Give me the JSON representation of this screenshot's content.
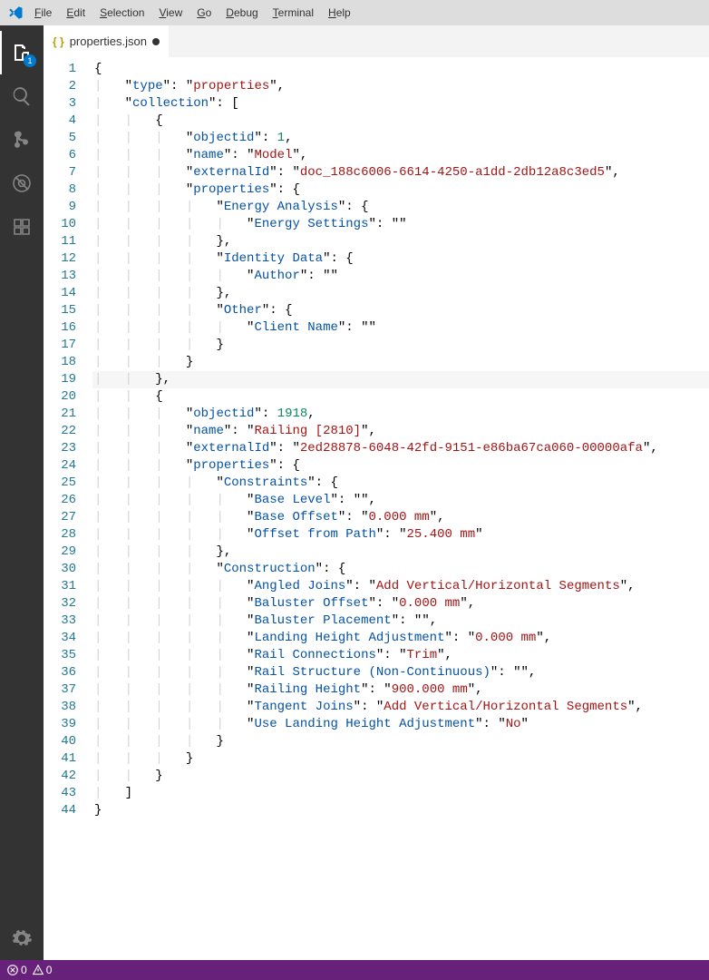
{
  "menubar": {
    "items": [
      {
        "label": "File",
        "ul": "F",
        "rest": "ile"
      },
      {
        "label": "Edit",
        "ul": "E",
        "rest": "dit"
      },
      {
        "label": "Selection",
        "ul": "S",
        "rest": "election"
      },
      {
        "label": "View",
        "ul": "V",
        "rest": "iew"
      },
      {
        "label": "Go",
        "ul": "G",
        "rest": "o"
      },
      {
        "label": "Debug",
        "ul": "D",
        "rest": "ebug"
      },
      {
        "label": "Terminal",
        "ul": "T",
        "rest": "erminal"
      },
      {
        "label": "Help",
        "ul": "H",
        "rest": "elp"
      }
    ]
  },
  "activitybar": {
    "explorer_badge": "1"
  },
  "tab": {
    "filename": "properties.json"
  },
  "code": {
    "lines": [
      [
        [
          "p",
          "{"
        ]
      ],
      [
        [
          "sp",
          "    "
        ],
        [
          "p",
          "\""
        ],
        [
          "k",
          "type"
        ],
        [
          "p",
          "\": "
        ],
        [
          "p",
          "\""
        ],
        [
          "s",
          "properties"
        ],
        [
          "p",
          "\","
        ]
      ],
      [
        [
          "sp",
          "    "
        ],
        [
          "p",
          "\""
        ],
        [
          "k",
          "collection"
        ],
        [
          "p",
          "\": ["
        ]
      ],
      [
        [
          "sp",
          "        "
        ],
        [
          "p",
          "{"
        ]
      ],
      [
        [
          "sp",
          "            "
        ],
        [
          "p",
          "\""
        ],
        [
          "k",
          "objectid"
        ],
        [
          "p",
          "\": "
        ],
        [
          "n",
          "1"
        ],
        [
          "p",
          ","
        ]
      ],
      [
        [
          "sp",
          "            "
        ],
        [
          "p",
          "\""
        ],
        [
          "k",
          "name"
        ],
        [
          "p",
          "\": "
        ],
        [
          "p",
          "\""
        ],
        [
          "s",
          "Model"
        ],
        [
          "p",
          "\","
        ]
      ],
      [
        [
          "sp",
          "            "
        ],
        [
          "p",
          "\""
        ],
        [
          "k",
          "externalId"
        ],
        [
          "p",
          "\": "
        ],
        [
          "p",
          "\""
        ],
        [
          "s",
          "doc_188c6006-6614-4250-a1dd-2db12a8c3ed5"
        ],
        [
          "p",
          "\","
        ]
      ],
      [
        [
          "sp",
          "            "
        ],
        [
          "p",
          "\""
        ],
        [
          "k",
          "properties"
        ],
        [
          "p",
          "\": {"
        ]
      ],
      [
        [
          "sp",
          "                "
        ],
        [
          "p",
          "\""
        ],
        [
          "k",
          "Energy Analysis"
        ],
        [
          "p",
          "\": {"
        ]
      ],
      [
        [
          "sp",
          "                    "
        ],
        [
          "p",
          "\""
        ],
        [
          "k",
          "Energy Settings"
        ],
        [
          "p",
          "\": "
        ],
        [
          "p",
          "\""
        ],
        [
          "p",
          "\""
        ]
      ],
      [
        [
          "sp",
          "                "
        ],
        [
          "p",
          "},"
        ]
      ],
      [
        [
          "sp",
          "                "
        ],
        [
          "p",
          "\""
        ],
        [
          "k",
          "Identity Data"
        ],
        [
          "p",
          "\": {"
        ]
      ],
      [
        [
          "sp",
          "                    "
        ],
        [
          "p",
          "\""
        ],
        [
          "k",
          "Author"
        ],
        [
          "p",
          "\": "
        ],
        [
          "p",
          "\""
        ],
        [
          "p",
          "\""
        ]
      ],
      [
        [
          "sp",
          "                "
        ],
        [
          "p",
          "},"
        ]
      ],
      [
        [
          "sp",
          "                "
        ],
        [
          "p",
          "\""
        ],
        [
          "k",
          "Other"
        ],
        [
          "p",
          "\": {"
        ]
      ],
      [
        [
          "sp",
          "                    "
        ],
        [
          "p",
          "\""
        ],
        [
          "k",
          "Client Name"
        ],
        [
          "p",
          "\": "
        ],
        [
          "p",
          "\""
        ],
        [
          "p",
          "\""
        ]
      ],
      [
        [
          "sp",
          "                "
        ],
        [
          "p",
          "}"
        ]
      ],
      [
        [
          "sp",
          "            "
        ],
        [
          "p",
          "}"
        ]
      ],
      [
        [
          "sp",
          "        "
        ],
        [
          "p",
          "},"
        ]
      ],
      [
        [
          "sp",
          "        "
        ],
        [
          "p",
          "{"
        ]
      ],
      [
        [
          "sp",
          "            "
        ],
        [
          "p",
          "\""
        ],
        [
          "k",
          "objectid"
        ],
        [
          "p",
          "\": "
        ],
        [
          "n",
          "1918"
        ],
        [
          "p",
          ","
        ]
      ],
      [
        [
          "sp",
          "            "
        ],
        [
          "p",
          "\""
        ],
        [
          "k",
          "name"
        ],
        [
          "p",
          "\": "
        ],
        [
          "p",
          "\""
        ],
        [
          "s",
          "Railing [2810]"
        ],
        [
          "p",
          "\","
        ]
      ],
      [
        [
          "sp",
          "            "
        ],
        [
          "p",
          "\""
        ],
        [
          "k",
          "externalId"
        ],
        [
          "p",
          "\": "
        ],
        [
          "p",
          "\""
        ],
        [
          "s",
          "2ed28878-6048-42fd-9151-e86ba67ca060-00000afa"
        ],
        [
          "p",
          "\","
        ]
      ],
      [
        [
          "sp",
          "            "
        ],
        [
          "p",
          "\""
        ],
        [
          "k",
          "properties"
        ],
        [
          "p",
          "\": {"
        ]
      ],
      [
        [
          "sp",
          "                "
        ],
        [
          "p",
          "\""
        ],
        [
          "k",
          "Constraints"
        ],
        [
          "p",
          "\": {"
        ]
      ],
      [
        [
          "sp",
          "                    "
        ],
        [
          "p",
          "\""
        ],
        [
          "k",
          "Base Level"
        ],
        [
          "p",
          "\": "
        ],
        [
          "p",
          "\""
        ],
        [
          "p",
          "\","
        ]
      ],
      [
        [
          "sp",
          "                    "
        ],
        [
          "p",
          "\""
        ],
        [
          "k",
          "Base Offset"
        ],
        [
          "p",
          "\": "
        ],
        [
          "p",
          "\""
        ],
        [
          "s",
          "0.000 mm"
        ],
        [
          "p",
          "\","
        ]
      ],
      [
        [
          "sp",
          "                    "
        ],
        [
          "p",
          "\""
        ],
        [
          "k",
          "Offset from Path"
        ],
        [
          "p",
          "\": "
        ],
        [
          "p",
          "\""
        ],
        [
          "s",
          "25.400 mm"
        ],
        [
          "p",
          "\""
        ]
      ],
      [
        [
          "sp",
          "                "
        ],
        [
          "p",
          "},"
        ]
      ],
      [
        [
          "sp",
          "                "
        ],
        [
          "p",
          "\""
        ],
        [
          "k",
          "Construction"
        ],
        [
          "p",
          "\": {"
        ]
      ],
      [
        [
          "sp",
          "                    "
        ],
        [
          "p",
          "\""
        ],
        [
          "k",
          "Angled Joins"
        ],
        [
          "p",
          "\": "
        ],
        [
          "p",
          "\""
        ],
        [
          "s",
          "Add Vertical/Horizontal Segments"
        ],
        [
          "p",
          "\","
        ]
      ],
      [
        [
          "sp",
          "                    "
        ],
        [
          "p",
          "\""
        ],
        [
          "k",
          "Baluster Offset"
        ],
        [
          "p",
          "\": "
        ],
        [
          "p",
          "\""
        ],
        [
          "s",
          "0.000 mm"
        ],
        [
          "p",
          "\","
        ]
      ],
      [
        [
          "sp",
          "                    "
        ],
        [
          "p",
          "\""
        ],
        [
          "k",
          "Baluster Placement"
        ],
        [
          "p",
          "\": "
        ],
        [
          "p",
          "\""
        ],
        [
          "p",
          "\","
        ]
      ],
      [
        [
          "sp",
          "                    "
        ],
        [
          "p",
          "\""
        ],
        [
          "k",
          "Landing Height Adjustment"
        ],
        [
          "p",
          "\": "
        ],
        [
          "p",
          "\""
        ],
        [
          "s",
          "0.000 mm"
        ],
        [
          "p",
          "\","
        ]
      ],
      [
        [
          "sp",
          "                    "
        ],
        [
          "p",
          "\""
        ],
        [
          "k",
          "Rail Connections"
        ],
        [
          "p",
          "\": "
        ],
        [
          "p",
          "\""
        ],
        [
          "s",
          "Trim"
        ],
        [
          "p",
          "\","
        ]
      ],
      [
        [
          "sp",
          "                    "
        ],
        [
          "p",
          "\""
        ],
        [
          "k",
          "Rail Structure (Non-Continuous)"
        ],
        [
          "p",
          "\": "
        ],
        [
          "p",
          "\""
        ],
        [
          "p",
          "\","
        ]
      ],
      [
        [
          "sp",
          "                    "
        ],
        [
          "p",
          "\""
        ],
        [
          "k",
          "Railing Height"
        ],
        [
          "p",
          "\": "
        ],
        [
          "p",
          "\""
        ],
        [
          "s",
          "900.000 mm"
        ],
        [
          "p",
          "\","
        ]
      ],
      [
        [
          "sp",
          "                    "
        ],
        [
          "p",
          "\""
        ],
        [
          "k",
          "Tangent Joins"
        ],
        [
          "p",
          "\": "
        ],
        [
          "p",
          "\""
        ],
        [
          "s",
          "Add Vertical/Horizontal Segments"
        ],
        [
          "p",
          "\","
        ]
      ],
      [
        [
          "sp",
          "                    "
        ],
        [
          "p",
          "\""
        ],
        [
          "k",
          "Use Landing Height Adjustment"
        ],
        [
          "p",
          "\": "
        ],
        [
          "p",
          "\""
        ],
        [
          "s",
          "No"
        ],
        [
          "p",
          "\""
        ]
      ],
      [
        [
          "sp",
          "                "
        ],
        [
          "p",
          "}"
        ]
      ],
      [
        [
          "sp",
          "            "
        ],
        [
          "p",
          "}"
        ]
      ],
      [
        [
          "sp",
          "        "
        ],
        [
          "p",
          "}"
        ]
      ],
      [
        [
          "sp",
          "    "
        ],
        [
          "p",
          "]"
        ]
      ],
      [
        [
          "p",
          "}"
        ]
      ]
    ],
    "highlighted_line": 19
  },
  "statusbar": {
    "errors": "0",
    "warnings": "0"
  }
}
